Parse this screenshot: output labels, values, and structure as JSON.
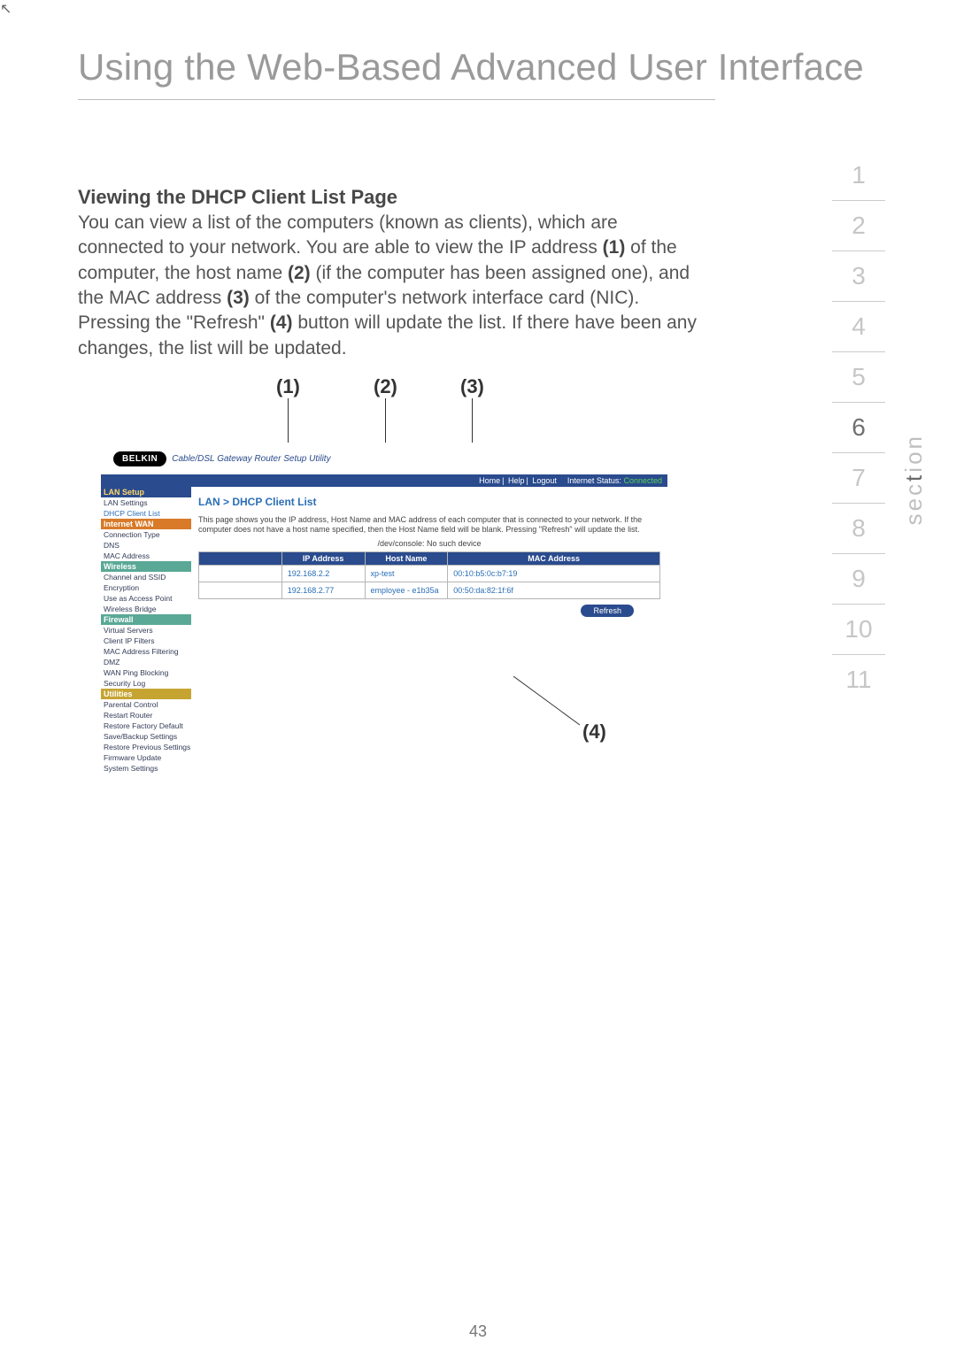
{
  "doc": {
    "title": "Using the Web-Based Advanced User Interface",
    "page_number": "43",
    "section_heading": "Viewing the DHCP Client List Page",
    "body_html": "You can view a list of the computers (known as clients), which are connected to your network. You are able to view the IP address <b>(1)</b> of the computer, the host name <b>(2)</b> (if the computer has been assigned one), and the MAC address <b>(3)</b> of the computer's network interface card (NIC). Pressing the \"Refresh\" <b>(4)</b> button will update the list. If there have been any changes, the list will be updated.",
    "callouts": {
      "c1": "(1)",
      "c2": "(2)",
      "c3": "(3)",
      "c4": "(4)"
    },
    "section_word": "section"
  },
  "nav": {
    "items": [
      "1",
      "2",
      "3",
      "4",
      "5",
      "6",
      "7",
      "8",
      "9",
      "10",
      "11"
    ],
    "active_index": 5
  },
  "shot": {
    "brand": "BELKIN",
    "brand_sub": "Cable/DSL Gateway Router Setup Utility",
    "topbar_links": [
      "Home",
      "Help",
      "Logout"
    ],
    "topbar_status_label": "Internet Status:",
    "topbar_status_value": "Connected",
    "crumb": "LAN > DHCP Client List",
    "desc": "This page shows you the IP address, Host Name and MAC address of each computer that is connected to your network. If the computer does not have a host name specified, then the Host Name field will be blank. Pressing \"Refresh\" will update the list.",
    "warn": "/dev/console: No such device",
    "refresh_label": "Refresh",
    "sidebar": [
      {
        "type": "hdr",
        "cls": "",
        "label": "LAN Setup"
      },
      {
        "type": "item",
        "cls": "",
        "label": "LAN Settings"
      },
      {
        "type": "item",
        "cls": "active",
        "label": "DHCP Client List"
      },
      {
        "type": "hdr",
        "cls": "orange",
        "label": "Internet WAN"
      },
      {
        "type": "item",
        "cls": "",
        "label": "Connection Type"
      },
      {
        "type": "item",
        "cls": "",
        "label": "DNS"
      },
      {
        "type": "item",
        "cls": "",
        "label": "MAC Address"
      },
      {
        "type": "hdr",
        "cls": "teal",
        "label": "Wireless"
      },
      {
        "type": "item",
        "cls": "",
        "label": "Channel and SSID"
      },
      {
        "type": "item",
        "cls": "",
        "label": "Encryption"
      },
      {
        "type": "item",
        "cls": "",
        "label": "Use as Access Point"
      },
      {
        "type": "item",
        "cls": "",
        "label": "Wireless Bridge"
      },
      {
        "type": "hdr",
        "cls": "teal",
        "label": "Firewall"
      },
      {
        "type": "item",
        "cls": "",
        "label": "Virtual Servers"
      },
      {
        "type": "item",
        "cls": "",
        "label": "Client IP Filters"
      },
      {
        "type": "item",
        "cls": "",
        "label": "MAC Address Filtering"
      },
      {
        "type": "item",
        "cls": "",
        "label": "DMZ"
      },
      {
        "type": "item",
        "cls": "",
        "label": "WAN Ping Blocking"
      },
      {
        "type": "item",
        "cls": "",
        "label": "Security Log"
      },
      {
        "type": "hdr",
        "cls": "gold",
        "label": "Utilities"
      },
      {
        "type": "item",
        "cls": "",
        "label": "Parental Control"
      },
      {
        "type": "item",
        "cls": "",
        "label": "Restart Router"
      },
      {
        "type": "item",
        "cls": "",
        "label": "Restore Factory Default"
      },
      {
        "type": "item",
        "cls": "",
        "label": "Save/Backup Settings"
      },
      {
        "type": "item",
        "cls": "",
        "label": "Restore Previous Settings"
      },
      {
        "type": "item",
        "cls": "",
        "label": "Firmware Update"
      },
      {
        "type": "item",
        "cls": "",
        "label": "System Settings"
      }
    ],
    "table": {
      "headers": [
        "IP Address",
        "Host Name",
        "MAC Address"
      ],
      "rows": [
        {
          "ip": "192.168.2.2",
          "host": "xp-test",
          "mac": "00:10:b5:0c:b7:19"
        },
        {
          "ip": "192.168.2.77",
          "host": "employee - e1b35a",
          "mac": "00:50:da:82:1f:6f"
        }
      ]
    }
  },
  "chart_data": {
    "type": "table",
    "title": "DHCP Client List",
    "headers": [
      "IP Address",
      "Host Name",
      "MAC Address"
    ],
    "rows": [
      [
        "192.168.2.2",
        "xp-test",
        "00:10:b5:0c:b7:19"
      ],
      [
        "192.168.2.77",
        "employee - e1b35a",
        "00:50:da:82:1f:6f"
      ]
    ]
  }
}
